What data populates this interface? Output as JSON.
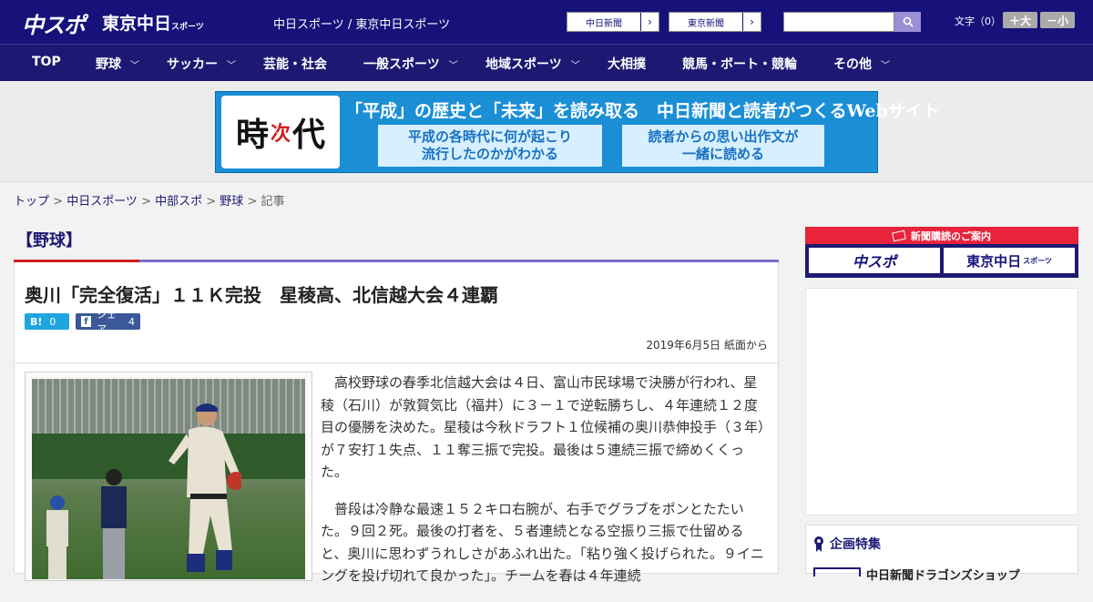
{
  "header": {
    "logo_main": "中スポ",
    "logo_sub": "東京中日",
    "logo_sub_small": "スポーツ",
    "site_names": "中日スポーツ / 東京中日スポーツ",
    "paper_links": [
      "中日新聞",
      "東京新聞"
    ],
    "font_label": "文字（0）",
    "font_larger": "＋大",
    "font_smaller": "－小"
  },
  "nav": {
    "items": [
      {
        "label": "TOP",
        "chevron": false
      },
      {
        "label": "野球",
        "chevron": true
      },
      {
        "label": "サッカー",
        "chevron": true
      },
      {
        "label": "芸能・社会",
        "chevron": false
      },
      {
        "label": "一般スポーツ",
        "chevron": true
      },
      {
        "label": "地域スポーツ",
        "chevron": true
      },
      {
        "label": "大相撲",
        "chevron": false
      },
      {
        "label": "競馬・ボート・競輪",
        "chevron": false
      },
      {
        "label": "その他",
        "chevron": true
      }
    ]
  },
  "banner": {
    "logo_a": "時",
    "logo_b": "次",
    "logo_c": "代",
    "headline": "「平成」の歴史と「未来」を読み取る　中日新聞と読者がつくるWebサイト",
    "box_left": "平成の各時代に何が起こり\n流行したのかがわかる",
    "box_right": "読者からの思い出作文が\n一緒に読める"
  },
  "breadcrumb": {
    "items": [
      "トップ",
      "中日スポーツ",
      "中部スポ",
      "野球"
    ],
    "current": "記事",
    "sep": " > "
  },
  "article": {
    "category": "【野球】",
    "headline": "奥川「完全復活」１１Ｋ完投　星稜高、北信越大会４連覇",
    "hatena_label": "B!",
    "hatena_count": "0",
    "fb_icon": "f",
    "fb_label": "シェア",
    "fb_count": "4",
    "date": "2019年6月5日 紙面から",
    "paragraphs": [
      "高校野球の春季北信越大会は４日、富山市民球場で決勝が行われ、星稜（石川）が敦賀気比（福井）に３－１で逆転勝ちし、４年連続１２度目の優勝を決めた。星稜は今秋ドラフト１位候補の奥川恭伸投手（３年）が７安打１失点、１１奪三振で完投。最後は５連続三振で締めくくった。",
      "普段は冷静な最速１５２キロ右腕が、右手でグラブをポンとたたいた。９回２死。最後の打者を、５者連続となる空振り三振で仕留めると、奥川に思わずうれしさがあふれ出た。「粘り強く投げられた。９イニングを投げ切れて良かった」。チームを春は４年連続"
    ]
  },
  "sidebar": {
    "ad_title": "新聞購読のご案内",
    "ad_left": "中スポ",
    "ad_right": "東京中日",
    "ad_right_small": "スポーツ",
    "feature_title": "企画特集",
    "feature_item": "中日新聞ドラゴンズショップ"
  },
  "colors": {
    "header_bg": "#16127a",
    "accent_red": "#d21e1e",
    "accent_purple": "#7a6fc8",
    "hatena": "#1ea6e0",
    "facebook": "#3b5998"
  }
}
